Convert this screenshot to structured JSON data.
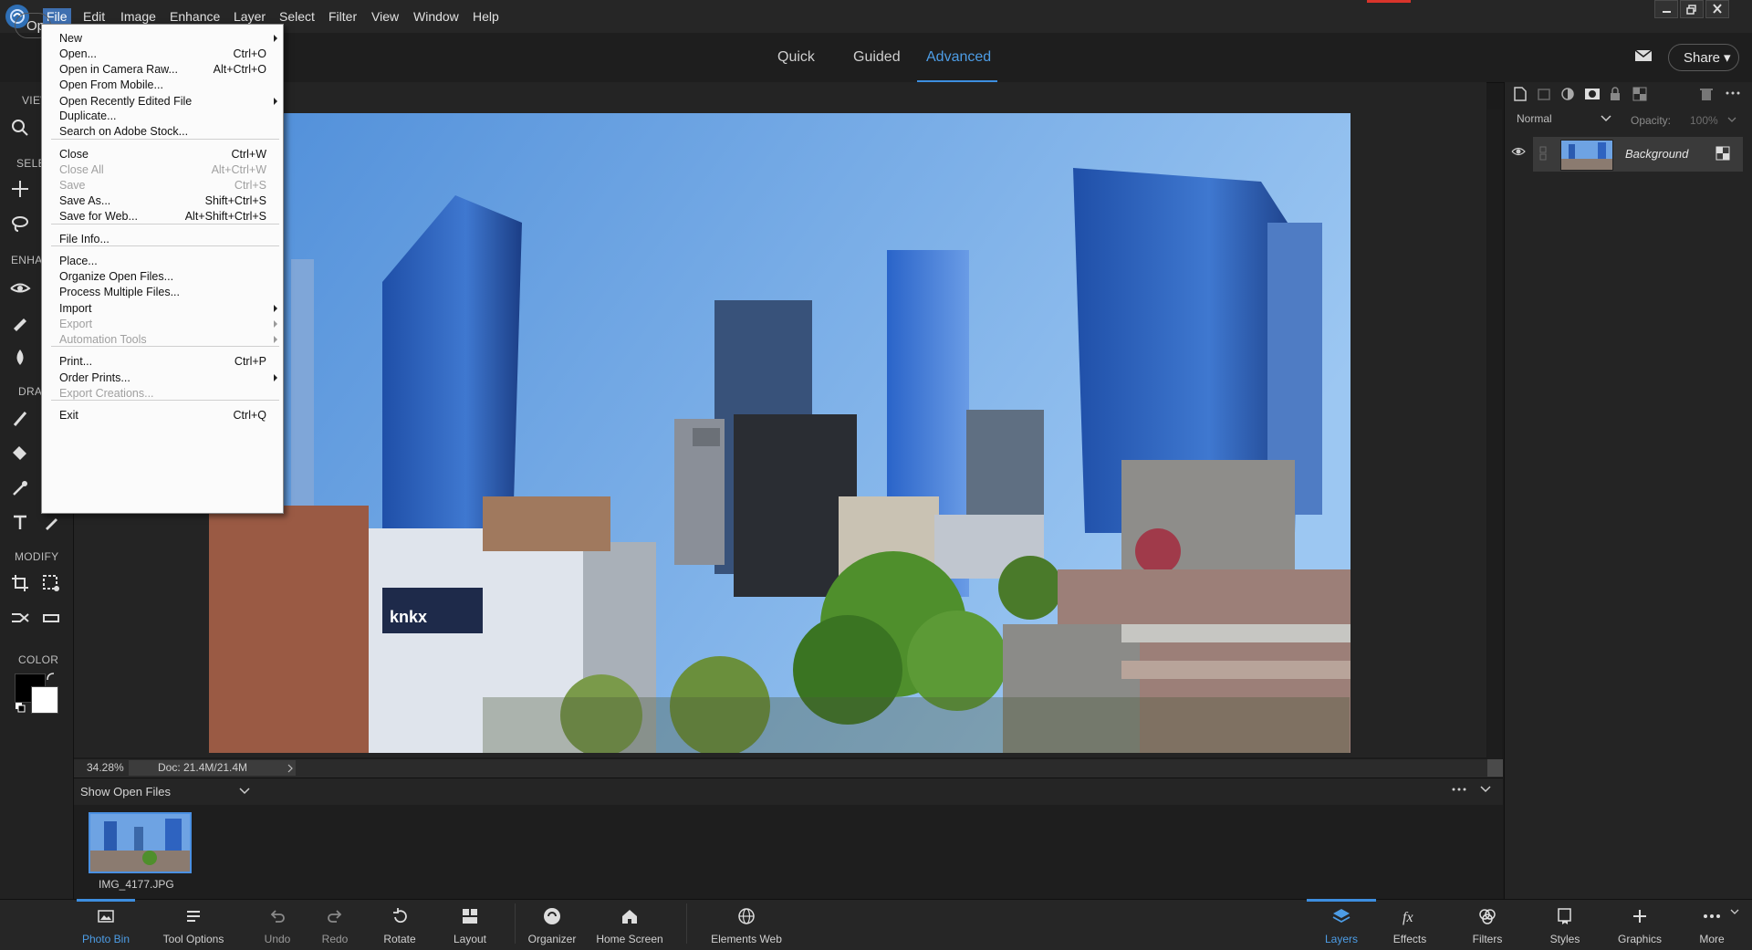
{
  "menubar": {
    "items": [
      "File",
      "Edit",
      "Image",
      "Enhance",
      "Layer",
      "Select",
      "Filter",
      "View",
      "Window",
      "Help"
    ]
  },
  "modes": [
    "Quick",
    "Guided",
    "Advanced"
  ],
  "header": {
    "open_label": "Op",
    "share_label": "Share"
  },
  "toolbox": {
    "sections": [
      "VIEW",
      "SELECT",
      "ENHANCE",
      "DRAW",
      "MODIFY",
      "COLOR"
    ]
  },
  "file_menu": {
    "items": [
      {
        "label": "New",
        "shortcut": "",
        "submenu": true,
        "disabled": false
      },
      {
        "label": "Open...",
        "shortcut": "Ctrl+O",
        "submenu": false,
        "disabled": false
      },
      {
        "label": "Open in Camera Raw...",
        "shortcut": "Alt+Ctrl+O",
        "submenu": false,
        "disabled": false
      },
      {
        "label": "Open From Mobile...",
        "shortcut": "",
        "submenu": false,
        "disabled": false
      },
      {
        "label": "Open Recently Edited File",
        "shortcut": "",
        "submenu": true,
        "disabled": false
      },
      {
        "label": "Duplicate...",
        "shortcut": "",
        "submenu": false,
        "disabled": false
      },
      {
        "label": "Search on Adobe Stock...",
        "shortcut": "",
        "submenu": false,
        "disabled": false
      },
      {
        "label": "Close",
        "shortcut": "Ctrl+W",
        "submenu": false,
        "disabled": false
      },
      {
        "label": "Close All",
        "shortcut": "Alt+Ctrl+W",
        "submenu": false,
        "disabled": true
      },
      {
        "label": "Save",
        "shortcut": "Ctrl+S",
        "submenu": false,
        "disabled": true
      },
      {
        "label": "Save As...",
        "shortcut": "Shift+Ctrl+S",
        "submenu": false,
        "disabled": false
      },
      {
        "label": "Save for Web...",
        "shortcut": "Alt+Shift+Ctrl+S",
        "submenu": false,
        "disabled": false
      },
      {
        "label": "File Info...",
        "shortcut": "",
        "submenu": false,
        "disabled": false
      },
      {
        "label": "Place...",
        "shortcut": "",
        "submenu": false,
        "disabled": false
      },
      {
        "label": "Organize Open Files...",
        "shortcut": "",
        "submenu": false,
        "disabled": false
      },
      {
        "label": "Process Multiple Files...",
        "shortcut": "",
        "submenu": false,
        "disabled": false
      },
      {
        "label": "Import",
        "shortcut": "",
        "submenu": true,
        "disabled": false
      },
      {
        "label": "Export",
        "shortcut": "",
        "submenu": true,
        "disabled": true
      },
      {
        "label": "Automation Tools",
        "shortcut": "",
        "submenu": true,
        "disabled": true
      },
      {
        "label": "Print...",
        "shortcut": "Ctrl+P",
        "submenu": false,
        "disabled": false
      },
      {
        "label": "Order Prints...",
        "shortcut": "",
        "submenu": true,
        "disabled": false
      },
      {
        "label": "Export Creations...",
        "shortcut": "",
        "submenu": false,
        "disabled": true
      },
      {
        "label": "Exit",
        "shortcut": "Ctrl+Q",
        "submenu": false,
        "disabled": false
      }
    ]
  },
  "status": {
    "zoom": "34.28%",
    "doc": "Doc: 21.4M/21.4M"
  },
  "photo_bin": {
    "dropdown_label": "Show Open Files",
    "file_name": "IMG_4177.JPG"
  },
  "layers_panel": {
    "blend_mode": "Normal",
    "opacity_label": "Opacity:",
    "opacity_value": "100%",
    "layer_name": "Background"
  },
  "taskbar": {
    "left": [
      {
        "label": "Photo Bin",
        "icon": "photo-bin-icon"
      },
      {
        "label": "Tool Options",
        "icon": "tool-options-icon"
      },
      {
        "label": "Undo",
        "icon": "undo-icon"
      },
      {
        "label": "Redo",
        "icon": "redo-icon"
      },
      {
        "label": "Rotate",
        "icon": "rotate-icon"
      },
      {
        "label": "Layout",
        "icon": "layout-icon"
      },
      {
        "label": "Organizer",
        "icon": "organizer-icon"
      },
      {
        "label": "Home Screen",
        "icon": "home-icon"
      },
      {
        "label": "Elements Web",
        "icon": "globe-icon"
      }
    ],
    "right": [
      {
        "label": "Layers",
        "icon": "layers-icon"
      },
      {
        "label": "Effects",
        "icon": "effects-icon"
      },
      {
        "label": "Filters",
        "icon": "filters-icon"
      },
      {
        "label": "Styles",
        "icon": "styles-icon"
      },
      {
        "label": "Graphics",
        "icon": "graphics-icon"
      },
      {
        "label": "More",
        "icon": "more-icon"
      }
    ]
  },
  "colors": {
    "accent": "#3d8ee0",
    "menu_highlight": "#3e6fb0",
    "foreground": "#000000",
    "background": "#ffffff"
  }
}
